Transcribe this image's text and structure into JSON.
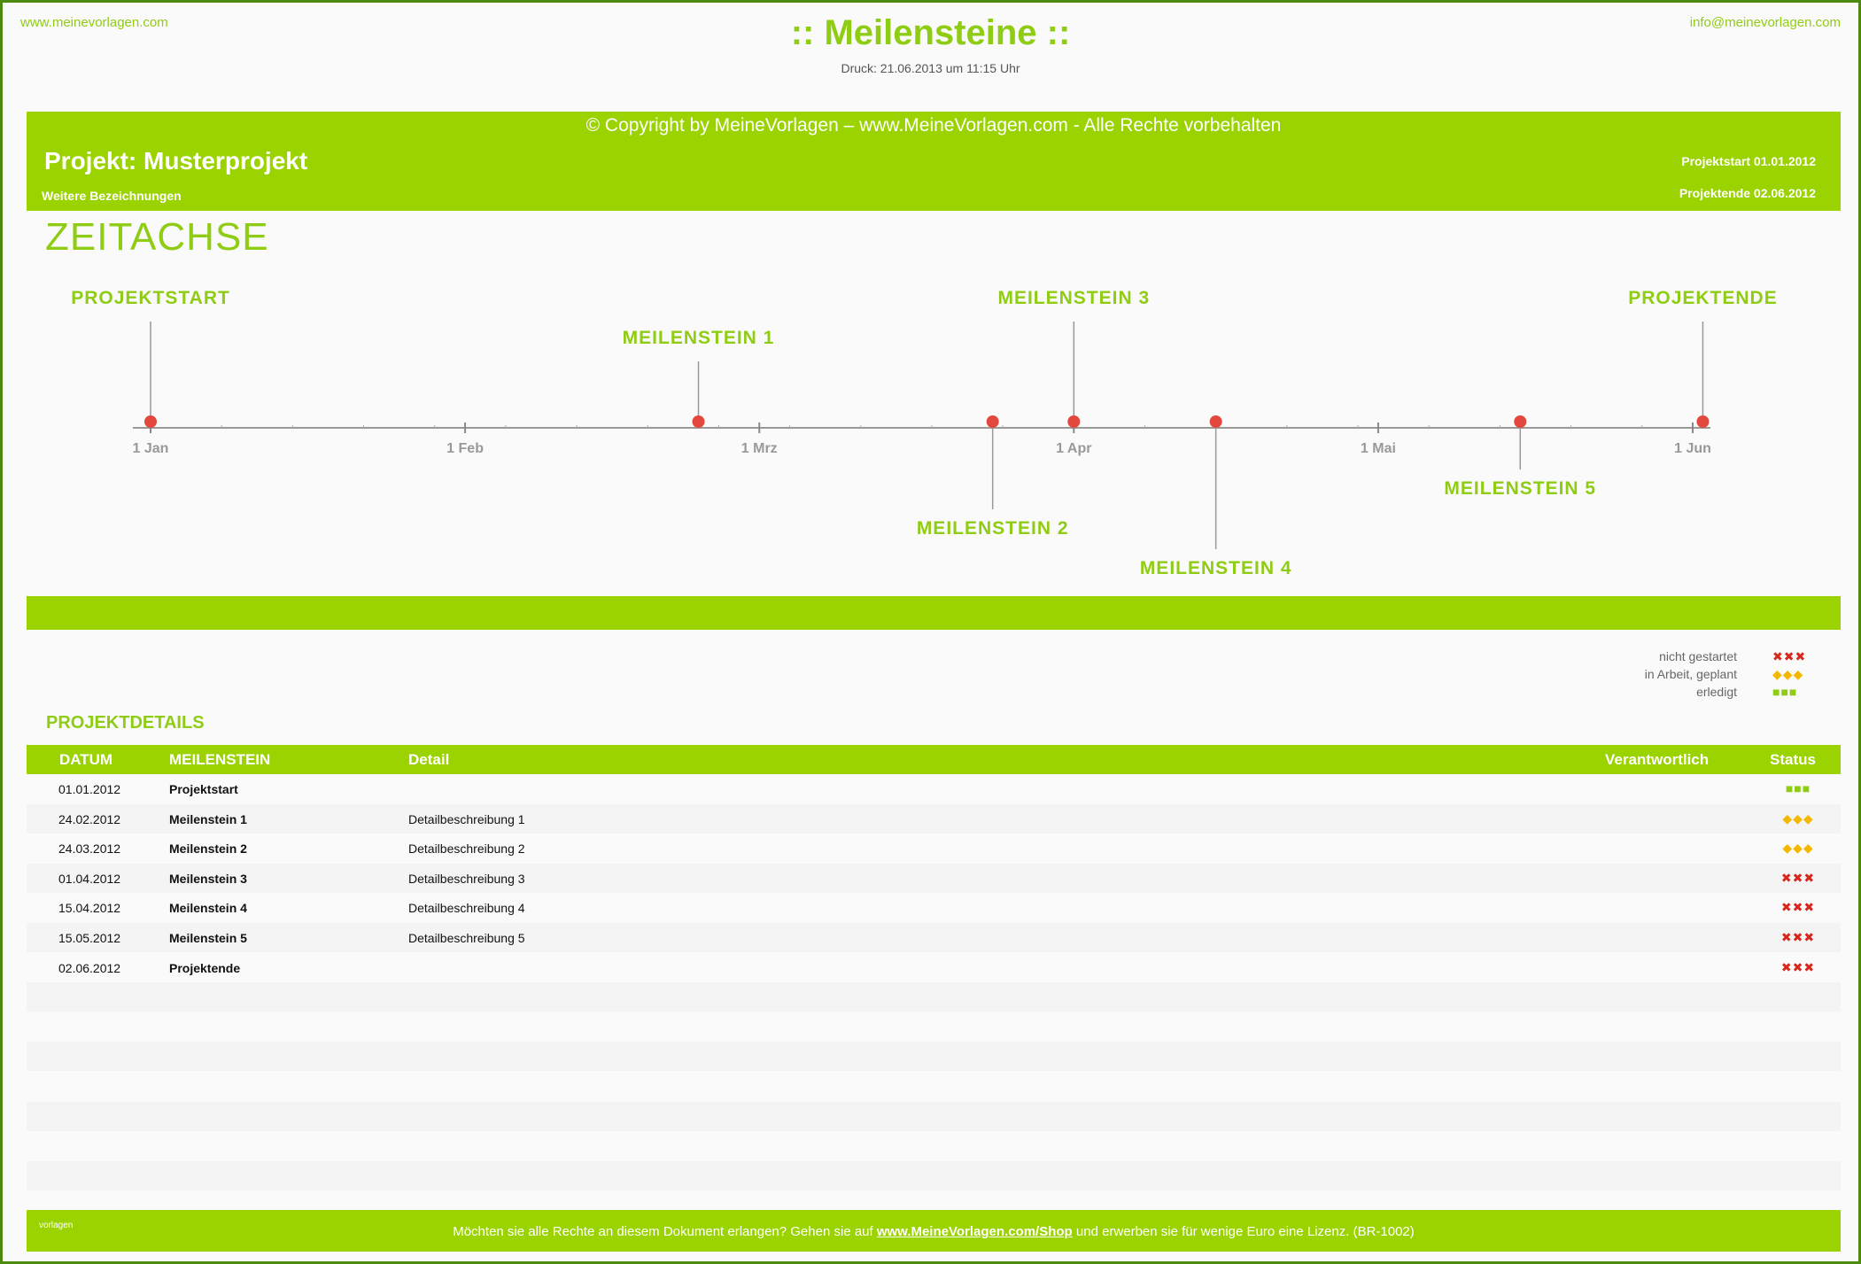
{
  "header": {
    "site_left": "www.meinevorlagen.com",
    "site_right": "info@meinevorlagen.com",
    "title": ":: Meilensteine ::",
    "print_line": "Druck: 21.06.2013 um 11:15 Uhr"
  },
  "project": {
    "copyright": "© Copyright by MeineVorlagen – www.MeineVorlagen.com - Alle Rechte vorbehalten",
    "name": "Projekt: Musterprojekt",
    "subtitle": "Weitere Bezeichnungen",
    "start": "Projektstart  01.01.2012",
    "end": "Projektende  02.06.2012"
  },
  "timeline": {
    "title": "ZEITACHSE",
    "months": [
      "1 Jan",
      "1 Feb",
      "1 Mrz",
      "1 Apr",
      "1 Mai",
      "1 Jun"
    ],
    "events": [
      {
        "label": "PROJEKTSTART",
        "date": "2012-01-01"
      },
      {
        "label": "MEILENSTEIN 1",
        "date": "2012-02-24"
      },
      {
        "label": "MEILENSTEIN 2",
        "date": "2012-03-24"
      },
      {
        "label": "MEILENSTEIN 3",
        "date": "2012-04-01"
      },
      {
        "label": "MEILENSTEIN 4",
        "date": "2012-04-15"
      },
      {
        "label": "MEILENSTEIN 5",
        "date": "2012-05-15"
      },
      {
        "label": "PROJEKTENDE",
        "date": "2012-06-02"
      }
    ],
    "marker_color": "#e2483e"
  },
  "legend": {
    "items": [
      {
        "label": "nicht gestartet",
        "icon": "✖✖✖",
        "color": "red"
      },
      {
        "label": "in Arbeit, geplant",
        "icon": "◆◆◆",
        "color": "yellow"
      },
      {
        "label": "erledigt",
        "icon": "■■■",
        "color": "green"
      }
    ]
  },
  "details": {
    "title": "PROJEKTDETAILS",
    "columns": {
      "date": "DATUM",
      "milestone": "MEILENSTEIN",
      "detail": "Detail",
      "owner": "Verantwortlich",
      "status": "Status"
    },
    "rows": [
      {
        "date": "01.01.2012",
        "milestone": "Projektstart",
        "detail": "",
        "owner": "",
        "status": "■■■",
        "status_color": "green"
      },
      {
        "date": "24.02.2012",
        "milestone": "Meilenstein 1",
        "detail": "Detailbeschreibung 1",
        "owner": "",
        "status": "◆◆◆",
        "status_color": "yellow"
      },
      {
        "date": "24.03.2012",
        "milestone": "Meilenstein 2",
        "detail": "Detailbeschreibung 2",
        "owner": "",
        "status": "◆◆◆",
        "status_color": "yellow"
      },
      {
        "date": "01.04.2012",
        "milestone": "Meilenstein 3",
        "detail": "Detailbeschreibung 3",
        "owner": "",
        "status": "✖✖✖",
        "status_color": "red"
      },
      {
        "date": "15.04.2012",
        "milestone": "Meilenstein 4",
        "detail": "Detailbeschreibung 4",
        "owner": "",
        "status": "✖✖✖",
        "status_color": "red"
      },
      {
        "date": "15.05.2012",
        "milestone": "Meilenstein 5",
        "detail": "Detailbeschreibung 5",
        "owner": "",
        "status": "✖✖✖",
        "status_color": "red"
      },
      {
        "date": "02.06.2012",
        "milestone": "Projektende",
        "detail": "",
        "owner": "",
        "status": "✖✖✖",
        "status_color": "red"
      }
    ]
  },
  "footer": {
    "small": "vorlagen",
    "text_before": "Möchten sie alle Rechte an diesem Dokument erlangen? Gehen sie auf ",
    "link": "www.MeineVorlagen.com/Shop",
    "text_after": " und erwerben sie für wenige Euro eine Lizenz. (BR-1002)"
  }
}
